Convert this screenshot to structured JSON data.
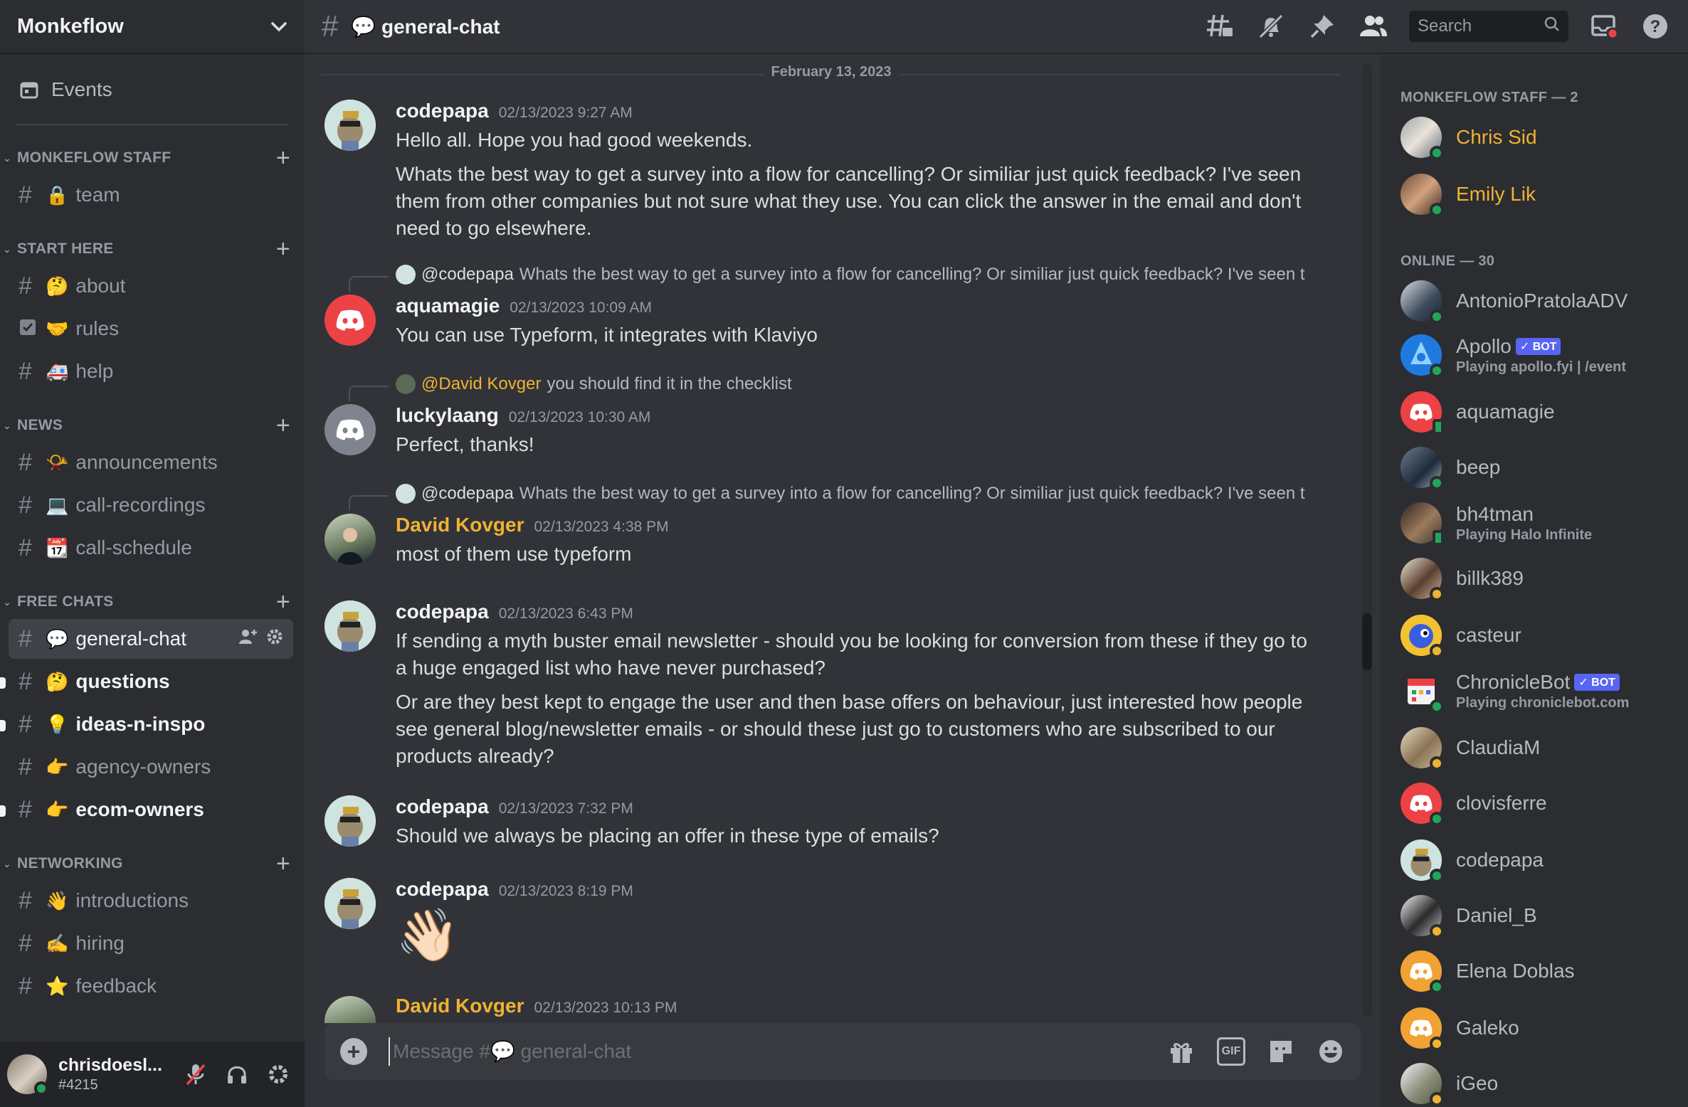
{
  "server": {
    "name": "Monkeflow"
  },
  "sidebar": {
    "events_label": "Events",
    "categories": [
      {
        "name": "MONKEFLOW STAFF",
        "channels": [
          {
            "emoji": "🔒",
            "name": "team"
          }
        ]
      },
      {
        "name": "START HERE",
        "channels": [
          {
            "emoji": "🤔",
            "name": "about"
          },
          {
            "emoji": "🤝",
            "name": "rules"
          },
          {
            "emoji": "🚑",
            "name": "help"
          }
        ]
      },
      {
        "name": "NEWS",
        "channels": [
          {
            "emoji": "📯",
            "name": "announcements"
          },
          {
            "emoji": "💻",
            "name": "call-recordings"
          },
          {
            "emoji": "📆",
            "name": "call-schedule"
          }
        ]
      },
      {
        "name": "FREE CHATS",
        "channels": [
          {
            "emoji": "💬",
            "name": "general-chat"
          },
          {
            "emoji": "🤔",
            "name": "questions"
          },
          {
            "emoji": "💡",
            "name": "ideas-n-inspo"
          },
          {
            "emoji": "👉",
            "name": "agency-owners"
          },
          {
            "emoji": "👉",
            "name": "ecom-owners"
          }
        ]
      },
      {
        "name": "NETWORKING",
        "channels": [
          {
            "emoji": "👋",
            "name": "introductions"
          },
          {
            "emoji": "✍️",
            "name": "hiring"
          },
          {
            "emoji": "⭐",
            "name": "feedback"
          }
        ]
      }
    ]
  },
  "user": {
    "name": "chrisdoesl...",
    "tag": "#4215"
  },
  "topbar": {
    "channel_title": "💬 general-chat",
    "search_placeholder": "Search"
  },
  "chat": {
    "date_divider": "February 13, 2023",
    "messages": [
      {
        "author": "codepapa",
        "time": "02/13/2023 9:27 AM",
        "lines": [
          "Hello all. Hope you had good weekends.",
          "Whats the best way to get a survey into a flow for cancelling? Or similiar just quick feedback? I've seen them from other companies but not sure what they use. You can click the answer in the email and don't need to go elsewhere."
        ]
      },
      {
        "reply_mention": "@codepapa",
        "reply_text": "Whats the best way to get a survey into a flow for cancelling? Or similiar just quick feedback? I've seen t",
        "author": "aquamagie",
        "time": "02/13/2023 10:09 AM",
        "text": "You can use Typeform, it integrates with Klaviyo"
      },
      {
        "reply_mention": "@David Kovger",
        "reply_text": "you should find it in the checklist",
        "author": "luckylaang",
        "time": "02/13/2023 10:30 AM",
        "text": "Perfect, thanks!"
      },
      {
        "reply_mention": "@codepapa",
        "reply_text": "Whats the best way to get a survey into a flow for cancelling? Or similiar just quick feedback? I've seen t",
        "author": "David Kovger",
        "time": "02/13/2023 4:38 PM",
        "text": "most of them use typeform"
      },
      {
        "author": "codepapa",
        "time": "02/13/2023 6:43 PM",
        "lines": [
          "If sending a myth buster email newsletter - should you be looking for conversion from these if they go to a huge engaged list who have never purchased?",
          "Or are they best kept to engage the user and then base offers on behaviour, just interested how people see general blog/newsletter emails  - or should these just go to customers who are subscribed to our products already?"
        ]
      },
      {
        "author": "codepapa",
        "time": "02/13/2023 7:32 PM",
        "text": "Should we always be placing an offer in these type of emails?"
      },
      {
        "author": "codepapa",
        "time": "02/13/2023 8:19 PM",
        "text": "👋🏻"
      },
      {
        "author": "David Kovger",
        "time": "02/13/2023 10:13 PM"
      }
    ]
  },
  "composer": {
    "placeholder": "Message #💬 general-chat",
    "gif_label": "GIF"
  },
  "members": {
    "staff_header": "MONKEFLOW STAFF — 2",
    "online_header": "ONLINE — 30",
    "bot_label": "✓ BOT",
    "staff": [
      {
        "name": "Chris Sid"
      },
      {
        "name": "Emily Lik"
      }
    ],
    "online": [
      {
        "name": "AntonioPratolaADV"
      },
      {
        "name": "Apollo",
        "activity": "Playing apollo.fyi | /event"
      },
      {
        "name": "aquamagie"
      },
      {
        "name": "beep"
      },
      {
        "name": "bh4tman",
        "activity": "Playing Halo Infinite"
      },
      {
        "name": "billk389"
      },
      {
        "name": "casteur"
      },
      {
        "name": "ChronicleBot",
        "activity": "Playing chroniclebot.com"
      },
      {
        "name": "ClaudiaM"
      },
      {
        "name": "clovisferre"
      },
      {
        "name": "codepapa"
      },
      {
        "name": "Daniel_B"
      },
      {
        "name": "Elena Doblas"
      },
      {
        "name": "Galeko"
      },
      {
        "name": "iGeo"
      }
    ]
  },
  "colors": {
    "accent_gold": "#f0b232",
    "online_green": "#23a55a",
    "discord_red": "#ed4245",
    "discord_orange": "#f0a232",
    "bot_blue": "#5865f2"
  }
}
